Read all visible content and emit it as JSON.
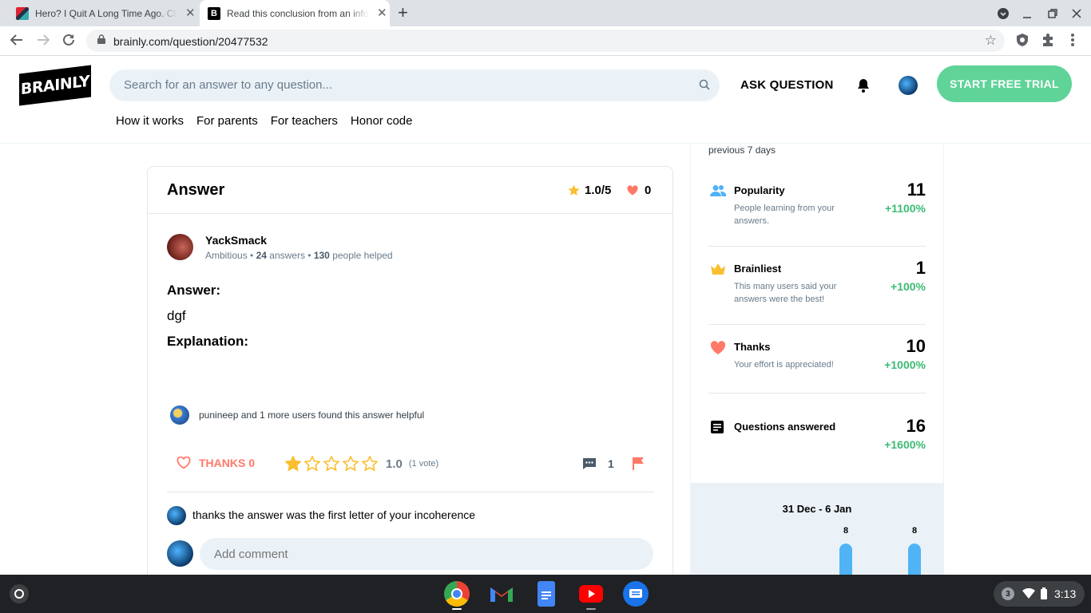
{
  "browser": {
    "tabs": [
      {
        "title": "Hero? I Quit A Long Time Ago. Chapter",
        "active": false
      },
      {
        "title": "Read this conclusion from an informational",
        "active": true
      }
    ],
    "address": "brainly.com/question/20477532"
  },
  "header": {
    "logo": "BRAINLY",
    "search_placeholder": "Search for an answer to any question...",
    "ask_label": "ASK QUESTION",
    "trial_label": "START FREE TRIAL",
    "nav": [
      "How it works",
      "For parents",
      "For teachers",
      "Honor code"
    ]
  },
  "answer": {
    "title": "Answer",
    "rating": "1.0/5",
    "hearts": "0",
    "author": {
      "name": "YackSmack",
      "rank": "Ambitious",
      "answers_count": "24",
      "answers_label": "answers",
      "helped_count": "130",
      "helped_label": "people helped"
    },
    "answer_label": "Answer:",
    "answer_text": "dgf",
    "explanation_label": "Explanation:",
    "helpful_text": "punineep and 1 more users found this answer helpful",
    "thanks_label": "THANKS 0",
    "stars_rating": 1,
    "stars_max": 5,
    "rating_value": "1.0",
    "votes": "(1 vote)",
    "comments_count": "1",
    "comment_text": "thanks the answer was the first letter of your incoherence",
    "add_comment_placeholder": "Add comment"
  },
  "stats": {
    "period": "previous 7 days",
    "items": [
      {
        "label": "Popularity",
        "desc": "People learning from your answers.",
        "value": "11",
        "change": "+1100%",
        "icon": "people-icon"
      },
      {
        "label": "Brainliest",
        "desc": "This many users said your answers were the best!",
        "value": "1",
        "change": "+100%",
        "icon": "crown-icon"
      },
      {
        "label": "Thanks",
        "desc": "Your effort is appreciated!",
        "value": "10",
        "change": "+1000%",
        "icon": "heart-icon"
      },
      {
        "label": "Questions answered",
        "desc": "",
        "value": "16",
        "change": "+1600%",
        "icon": "document-icon"
      }
    ],
    "chart_title": "31 Dec - 6 Jan",
    "bar_labels": [
      "8",
      "8"
    ]
  },
  "shelf": {
    "notification_count": "3",
    "time": "3:13"
  },
  "colors": {
    "brand_green": "#60d399",
    "accent_red": "#ff7968",
    "star_yellow": "#fbbe2e",
    "positive_green": "#3cbb74"
  }
}
